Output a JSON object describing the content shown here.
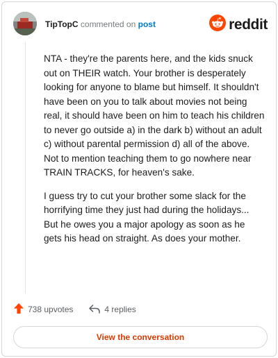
{
  "header": {
    "username": "TipTopC",
    "action_text": "commented on",
    "post_link": "post",
    "brand": "reddit"
  },
  "comment": {
    "paragraphs": [
      "NTA - they're the parents here, and the kids snuck out on THEIR watch. Your brother is desperately looking for anyone to blame but himself. It shouldn't have been on you to talk about movies not being real, it should have been on him to teach his children to never go outside a) in the dark b) without an adult c) without parental permission d) all of the above. Not to mention teaching them to go nowhere near TRAIN TRACKS, for heaven's sake.",
      "I guess try to cut your brother some slack for the horrifying time they just had during the holidays... But he owes you a major apology as soon as he gets his head on straight. As does your mother."
    ]
  },
  "actions": {
    "upvotes": "738 upvotes",
    "replies": "4 replies"
  },
  "footer": {
    "view_button": "View the conversation"
  },
  "colors": {
    "brand_orange": "#ff4500",
    "upvote_orange": "#ff4500",
    "link_blue": "#0079d3",
    "button_text": "#d93a00"
  },
  "icons": {
    "upvote": "upvote-arrow-icon",
    "reply": "reply-arrow-icon",
    "brand": "reddit-snoo-icon"
  }
}
